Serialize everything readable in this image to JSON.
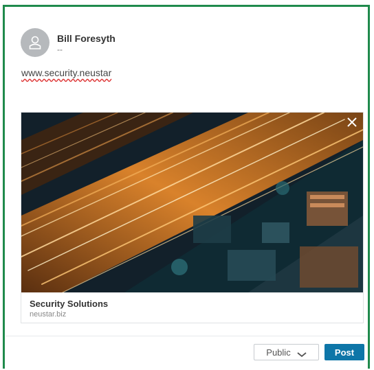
{
  "author": {
    "name": "Bill Foresyth",
    "subtitle": "--",
    "avatar_icon": "person-icon"
  },
  "post": {
    "text": "www.security.neustar"
  },
  "link_preview": {
    "title": "Security Solutions",
    "domain": "neustar.biz",
    "image_description_icon": "city-highway-photo",
    "close_icon": "close-icon"
  },
  "footer": {
    "visibility_label": "Public",
    "visibility_icon": "chevron-down-icon",
    "post_label": "Post"
  },
  "colors": {
    "frame_border": "#1f8a4c",
    "post_button": "#0e76a8"
  }
}
